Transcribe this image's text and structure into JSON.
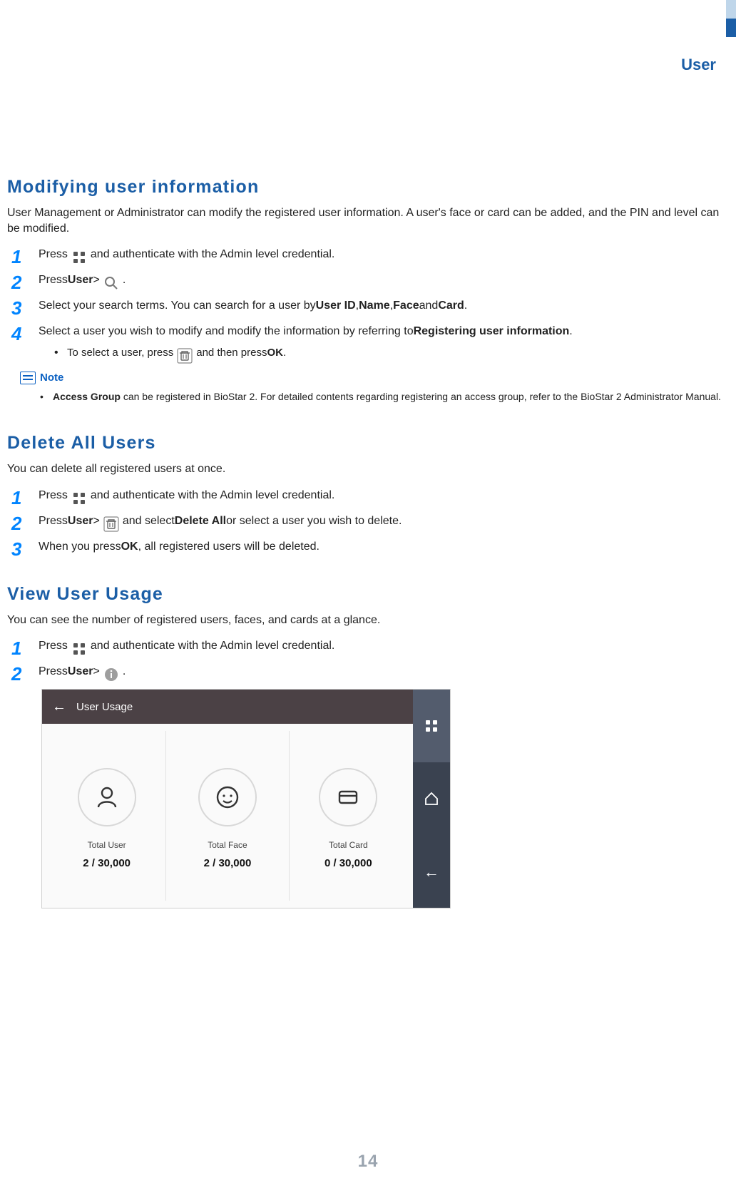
{
  "page": {
    "section_label": "User",
    "page_number": "14"
  },
  "modifying": {
    "heading": "Modifying user information",
    "intro": "User Management or Administrator can modify the registered user information. A user's face or card can be added, and the PIN and level can be modified.",
    "steps": {
      "s1_a": "Press ",
      "s1_b": " and authenticate with the Admin level credential.",
      "s2_a": "Press ",
      "s2_b_bold": "User",
      "s2_c": " > ",
      "s2_d": ".",
      "s3_a": "Select your search terms. You can search for a user by ",
      "s3_b1": "User ID",
      "s3_c1": ", ",
      "s3_b2": "Name",
      "s3_c2": ", ",
      "s3_b3": "Face",
      "s3_c3": " and ",
      "s3_b4": "Card",
      "s3_c4": ".",
      "s4_a": "Select a user you wish to modify and modify the information by referring to ",
      "s4_b": "Registering user information",
      "s4_c": ".",
      "s4_sub_a": "To select a user, press ",
      "s4_sub_b": " and then press ",
      "s4_sub_c": "OK",
      "s4_sub_d": "."
    },
    "note": {
      "label": "Note",
      "item_a_bold": "Access Group",
      "item_a_rest": " can be registered in BioStar 2. For detailed contents regarding registering an access group, refer to the BioStar 2 Administrator Manual."
    }
  },
  "delete": {
    "heading": "Delete All Users",
    "intro": "You can delete all registered users at once.",
    "steps": {
      "s1_a": "Press ",
      "s1_b": " and authenticate with the Admin level credential.",
      "s2_a": "Press ",
      "s2_b_bold": "User",
      "s2_c": " > ",
      "s2_d": " and select ",
      "s2_e_bold": "Delete All",
      "s2_f": " or select a user you wish to delete.",
      "s3_a": "When you press ",
      "s3_b": "OK",
      "s3_c": ", all registered users will be deleted."
    }
  },
  "usage": {
    "heading": "View User Usage",
    "intro": "You can see the number of registered users, faces, and cards at a glance.",
    "steps": {
      "s1_a": "Press ",
      "s1_b": " and authenticate with the Admin level credential.",
      "s2_a": "Press ",
      "s2_b_bold": "User",
      "s2_c": " > ",
      "s2_d": "."
    }
  },
  "screen": {
    "title": "User Usage",
    "cards": {
      "user": {
        "label": "Total User",
        "value": "2 / 30,000"
      },
      "face": {
        "label": "Total Face",
        "value": "2 / 30,000"
      },
      "card": {
        "label": "Total Card",
        "value": "0 / 30,000"
      }
    }
  },
  "nums": {
    "n1": "1",
    "n2": "2",
    "n3": "3",
    "n4": "4"
  }
}
